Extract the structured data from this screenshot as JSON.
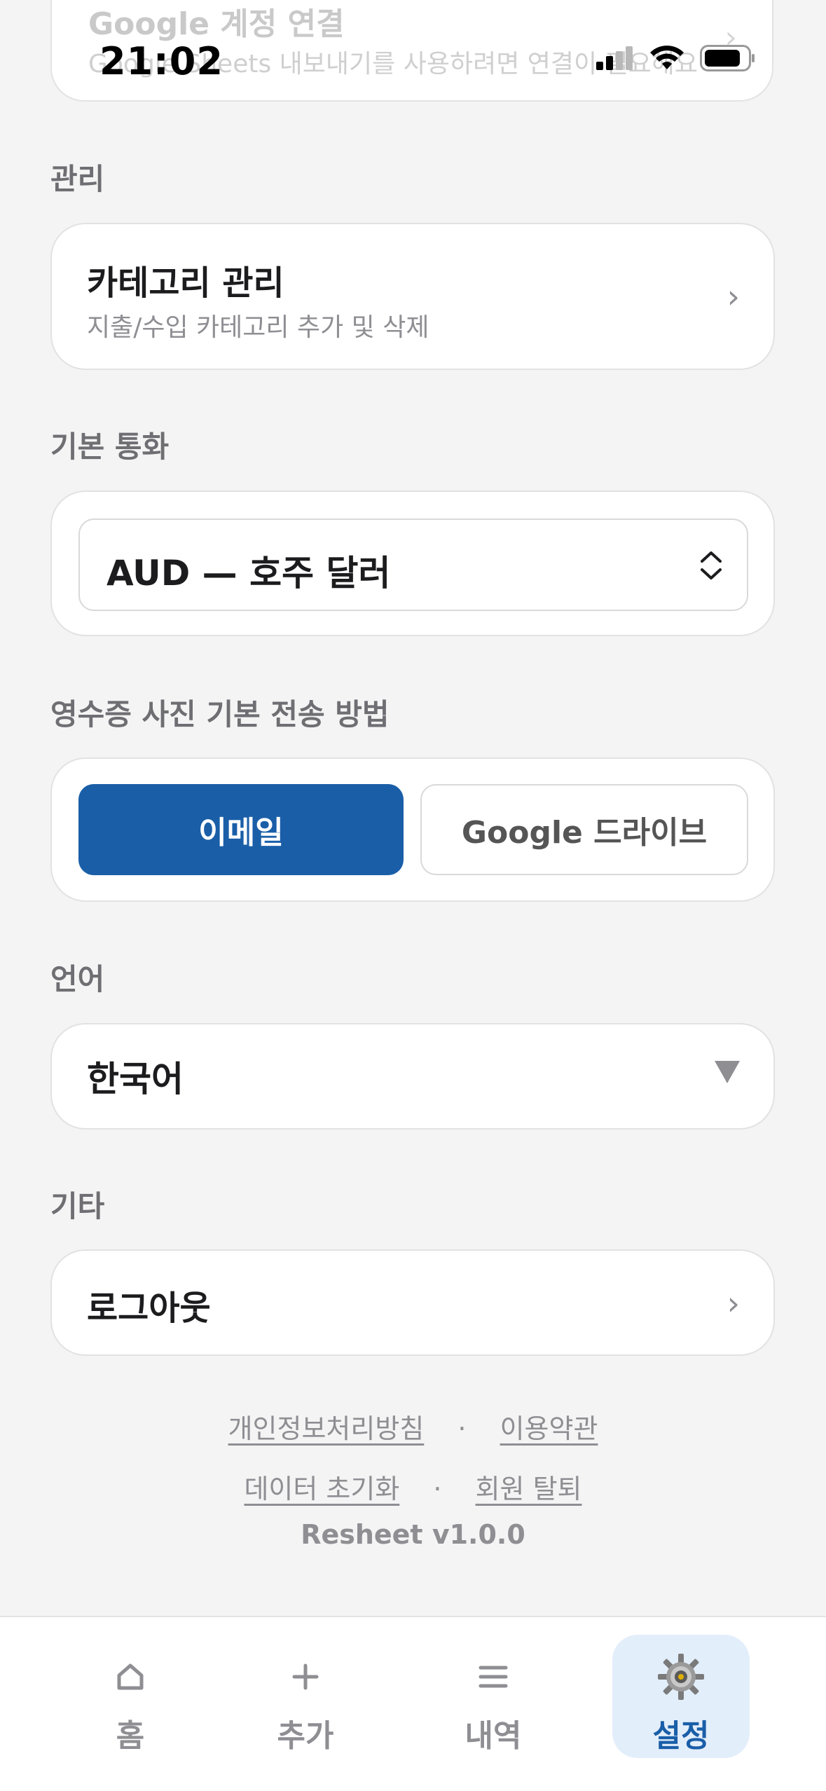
{
  "status_bar": {
    "time": "21:02"
  },
  "google_card": {
    "title": "Google 계정 연결",
    "description": "Google Sheets 내보내기를 사용하려면 연결이 필요해요"
  },
  "manage_section": {
    "label": "관리",
    "category_row": {
      "title": "카테고리 관리",
      "description": "지출/수입 카테고리 추가 및 삭제"
    }
  },
  "currency_section": {
    "label": "기본 통화",
    "selected": "AUD — 호주 달러"
  },
  "receipt_section": {
    "label": "영수증 사진 기본 전송 방법",
    "options": [
      {
        "label": "이메일",
        "selected": true
      },
      {
        "label": "Google 드라이브",
        "selected": false
      }
    ]
  },
  "language_section": {
    "label": "언어",
    "selected": "한국어"
  },
  "other_section": {
    "label": "기타",
    "logout_label": "로그아웃"
  },
  "footer": {
    "privacy_policy": "개인정보처리방침",
    "terms": "이용약관",
    "reset_data": "데이터 초기화",
    "delete_account": "회원 탈퇴",
    "separator": "·",
    "version": "Resheet v1.0.0"
  },
  "tab_bar": {
    "tabs": [
      {
        "label": "홈",
        "icon": "home-icon",
        "active": false
      },
      {
        "label": "추가",
        "icon": "plus-icon",
        "active": false
      },
      {
        "label": "내역",
        "icon": "list-icon",
        "active": false
      },
      {
        "label": "설정",
        "icon": "gear-icon",
        "active": true
      }
    ]
  },
  "colors": {
    "accent": "#1a5ea8",
    "background": "#f4f4f4",
    "active_tab_bg": "#e3eefb"
  }
}
